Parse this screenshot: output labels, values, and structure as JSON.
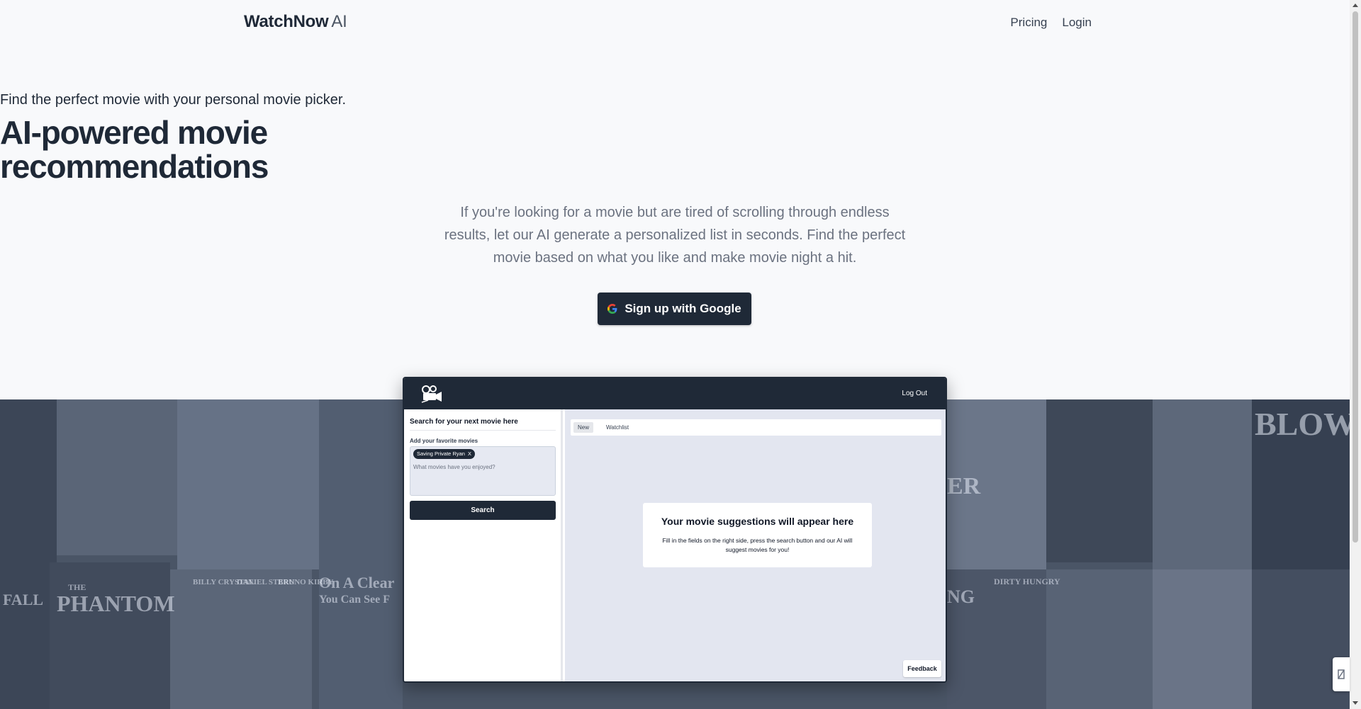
{
  "nav": {
    "logo_main": "WatchNow",
    "logo_suffix": "AI",
    "links": [
      "Pricing",
      "Login"
    ]
  },
  "hero": {
    "tagline": "Find the perfect movie with your personal movie picker.",
    "headline_line1": "AI-powered movie",
    "headline_line2": "recommendations",
    "lead": "If you're looking for a movie but are tired of scrolling through endless results, let our AI generate a personalized list in seconds. Find the perfect movie based on what you like and make movie night a hit.",
    "cta_label": "Sign up with Google",
    "cta_icon": "google-icon"
  },
  "collage_text": [
    "THE",
    "PHANTOM",
    "BILLY CRYSTAL",
    "DANIEL STERN",
    "BRUNO KIRBY",
    "On A Clear",
    "You Can See F",
    "FALL",
    "BLOW OU",
    "ER",
    "NG",
    "DIRTY HUNGRY"
  ],
  "preview": {
    "logout_label": "Log Out",
    "sidebar_title": "Search for your next movie here",
    "favorites_label": "Add your favorite movies",
    "chip_label": "Saving Private Ryan",
    "chip_remove": "X",
    "input_placeholder": "What movies have you enjoyed?",
    "search_label": "Search",
    "tabs": [
      "New",
      "Watchlist"
    ],
    "card_title": "Your movie suggestions will appear here",
    "card_body": "Fill in the fields on the right side, press the search button and our AI will suggest movies for you!",
    "feedback_label": "Feedback"
  },
  "colors": {
    "primary": "#1f2937",
    "page_bg": "#f8f9fb",
    "muted_text": "#6b7280",
    "preview_main_bg": "#e3e6f0"
  }
}
